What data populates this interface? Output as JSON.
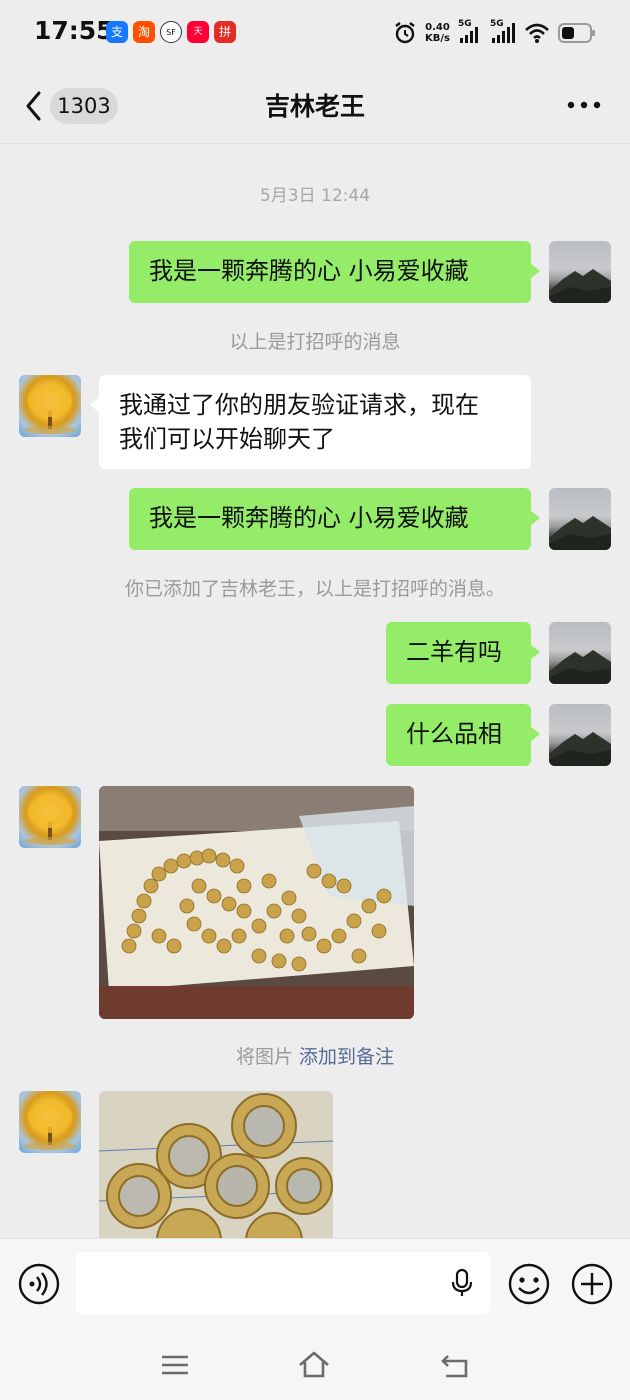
{
  "status_bar": {
    "time": "17:55",
    "app_icons": [
      "alipay",
      "taobao",
      "sf-express",
      "tmall",
      "pinduoduo"
    ],
    "net_speed_value": "0.40",
    "net_speed_unit": "KB/s",
    "signal1_label": "5G",
    "signal2_label": "5G"
  },
  "header": {
    "back_badge": "1303",
    "title": "吉林老王"
  },
  "chat": {
    "timestamp": "5月3日 12:44",
    "msg1": "我是一颗奔腾的心 小易爱收藏",
    "sys1": "以上是打招呼的消息",
    "msg2_line1": "我通过了你的朋友验证请求，现在",
    "msg2_line2": "我们可以开始聊天了",
    "msg3": "我是一颗奔腾的心 小易爱收藏",
    "sys2": "你已添加了吉林老王，以上是打招呼的消息。",
    "msg4": "二羊有吗",
    "msg5": "什么品相",
    "sys3_prefix": "将图片 ",
    "sys3_link": "添加到备注"
  },
  "colors": {
    "my_bubble": "#95ec69",
    "their_bubble": "#ffffff",
    "background": "#ededed",
    "link": "#576b95"
  }
}
